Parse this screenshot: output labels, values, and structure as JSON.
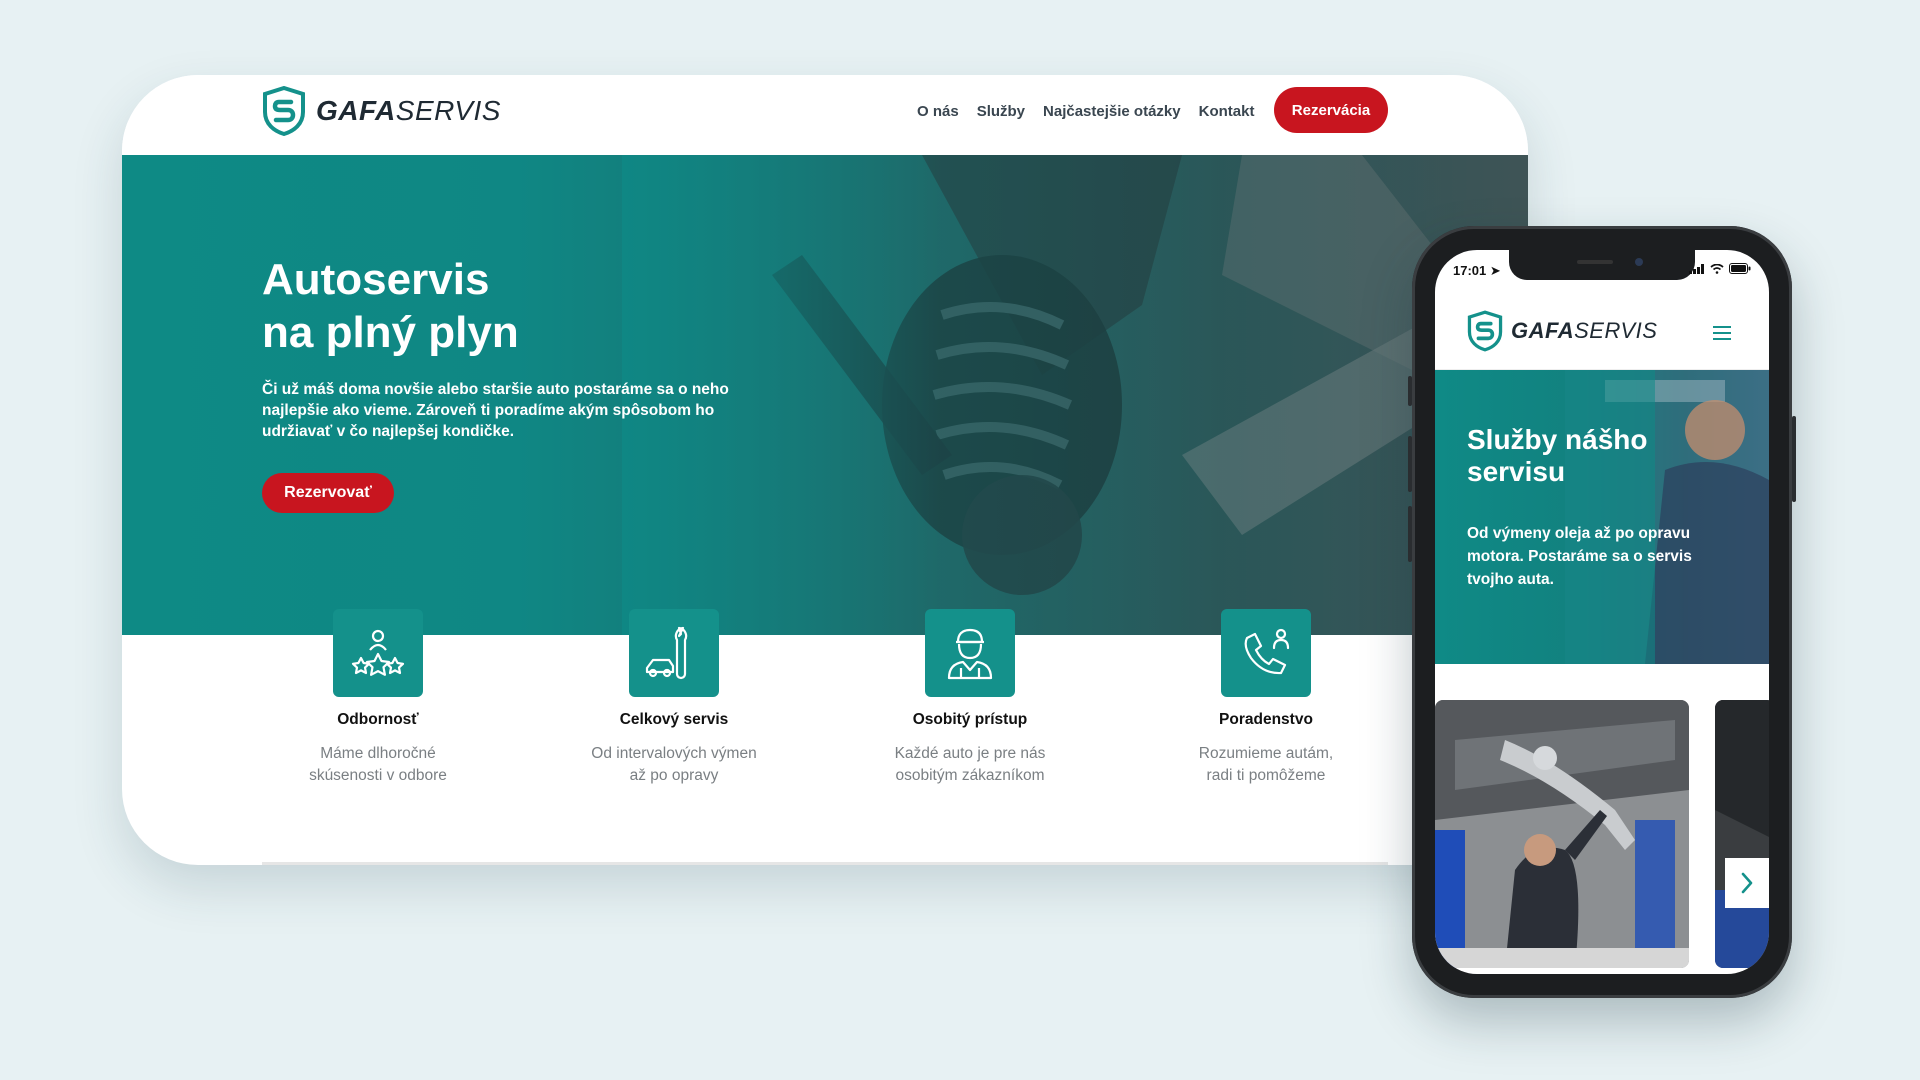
{
  "brand": {
    "name_bold": "GAFA",
    "name_light": "SERVIS",
    "shield_letter": "S"
  },
  "colors": {
    "teal": "#14918b",
    "red": "#c8151f",
    "dark": "#1f2a33",
    "muted": "#7a7f83"
  },
  "desktop": {
    "nav": [
      "O nás",
      "Služby",
      "Najčastejšie otázky",
      "Kontakt"
    ],
    "cta": "Rezervácia",
    "hero": {
      "title_line1": "Autoservis",
      "title_line2": "na plný plyn",
      "text": "Či už máš doma novšie alebo staršie auto postaráme sa o neho najlepšie ako vieme. Zároveň ti poradíme akým spôsobom ho udržiavať v čo najlepšej kondičke.",
      "button": "Rezervovať"
    },
    "features": [
      {
        "icon": "expert-stars-icon",
        "title": "Odbornosť",
        "line1": "Máme dlhoročné",
        "line2": "skúsenosti v odbore"
      },
      {
        "icon": "car-wrench-icon",
        "title": "Celkový servis",
        "line1": "Od intervalových výmen",
        "line2": "až po opravy"
      },
      {
        "icon": "mechanic-icon",
        "title": "Osobitý prístup",
        "line1": "Každé auto je pre nás",
        "line2": "osobitým zákazníkom"
      },
      {
        "icon": "phone-support-icon",
        "title": "Poradenstvo",
        "line1": "Rozumieme autám,",
        "line2": "radi ti pomôžeme"
      }
    ]
  },
  "mobile": {
    "status_time": "17:01",
    "hero": {
      "title": "Služby nášho servisu",
      "text": "Od výmeny oleja až po opravu motora. Postaráme sa o servis tvojho auta."
    }
  }
}
